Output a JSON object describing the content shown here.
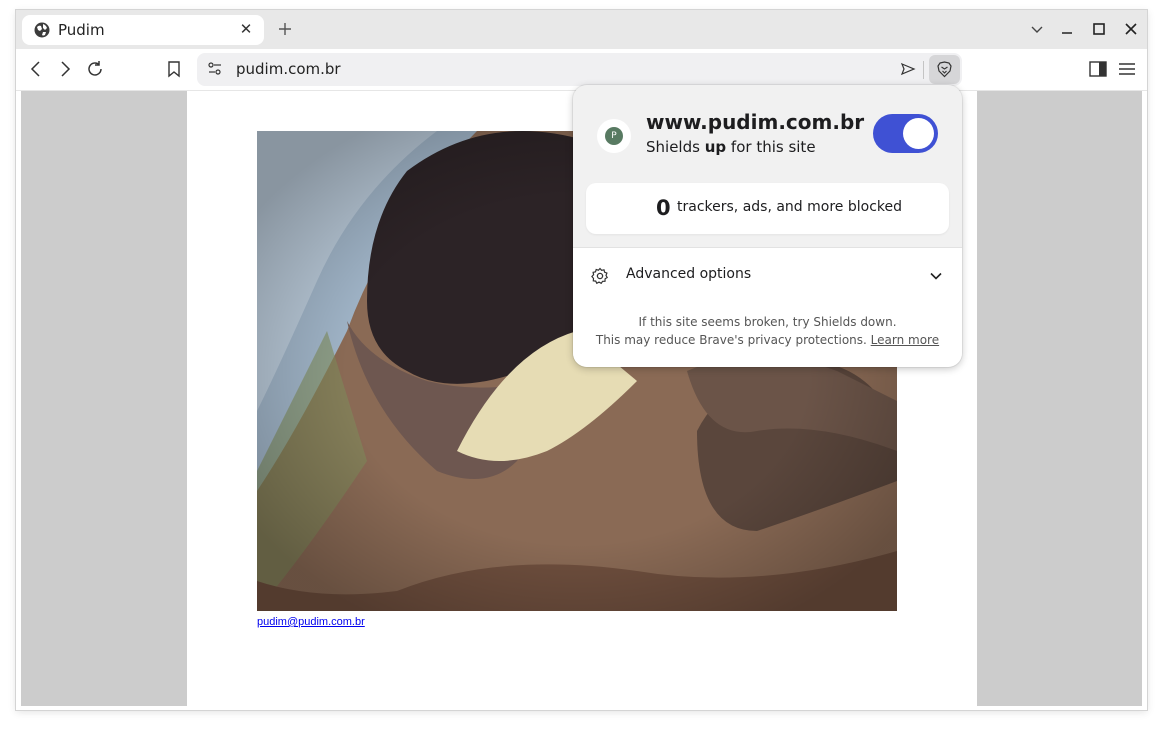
{
  "tab": {
    "title": "Pudim",
    "favicon": "globe-icon",
    "close_glyph": "✕"
  },
  "new_tab_icon": "plus-icon",
  "window_controls": [
    "chevron-down-icon",
    "minimize-icon",
    "maximize-icon",
    "close-icon"
  ],
  "toolbar": {
    "back_icon": "back-arrow-icon",
    "forward_icon": "forward-arrow-icon",
    "reload_icon": "reload-icon",
    "bookmark_icon": "bookmark-icon",
    "sidebar_icon": "sidebar-toggle-icon",
    "menu_icon": "hamburger-menu-icon"
  },
  "address_bar": {
    "url": "pudim.com.br",
    "site_info_icon": "site-settings-icon",
    "send_icon": "send-icon",
    "shields_icon": "brave-lion-icon"
  },
  "page": {
    "email": "pudim@pudim.com.br"
  },
  "shields_panel": {
    "avatar_letter": "P",
    "host": "www.pudim.com.br",
    "status_prefix": "Shields",
    "status_word": "up",
    "status_suffix": "for this site",
    "enabled": true,
    "toggle_color": "#3f51d4",
    "blocked_count": "0",
    "blocked_label": "trackers, ads, and more blocked",
    "advanced_label": "Advanced options",
    "footer_line1": "If this site seems broken, try Shields down.",
    "footer_line2": "This may reduce Brave's privacy protections.",
    "learn_more": "Learn more"
  }
}
